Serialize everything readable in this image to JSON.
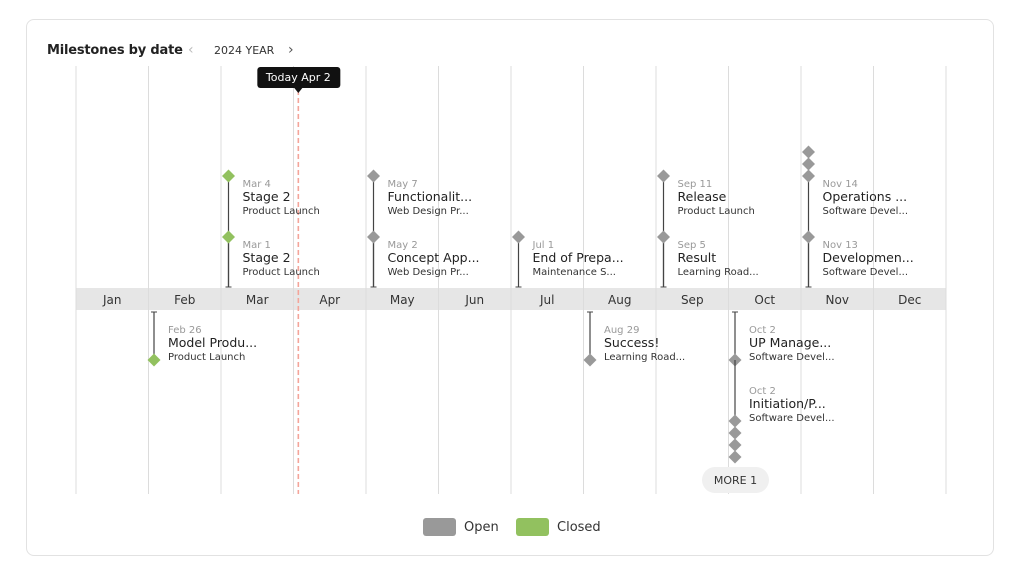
{
  "header": {
    "title": "Milestones by date",
    "prev_label": "‹",
    "year_label": "2024 YEAR",
    "next_label": "›"
  },
  "colors": {
    "open": "#999999",
    "closed": "#92c15f",
    "today": "#f4a59a",
    "band": "#e6e6e6",
    "grid": "#dcdcdc"
  },
  "chart_data": {
    "type": "timeline",
    "title": "Milestones by date",
    "year": 2024,
    "months": [
      "Jan",
      "Feb",
      "Mar",
      "Apr",
      "May",
      "Jun",
      "Jul",
      "Aug",
      "Sep",
      "Oct",
      "Nov",
      "Dec"
    ],
    "today": {
      "label": "Today Apr 2",
      "month": 4,
      "day": 2
    },
    "legend": [
      {
        "name": "Open",
        "color": "#999999"
      },
      {
        "name": "Closed",
        "color": "#92c15f"
      }
    ],
    "legend_position": "bottom",
    "milestones": [
      {
        "date": "Mar 4",
        "month": 3,
        "day": 4,
        "title": "Stage 2",
        "project": "Product Launch",
        "status": "closed",
        "side": "above",
        "slot": 2
      },
      {
        "date": "Mar 1",
        "month": 3,
        "day": 1,
        "title": "Stage 2",
        "project": "Product Launch",
        "status": "closed",
        "side": "above",
        "slot": 1
      },
      {
        "date": "May 7",
        "month": 5,
        "day": 7,
        "title": "Functionalit...",
        "project": "Web Design Pr...",
        "status": "open",
        "side": "above",
        "slot": 2
      },
      {
        "date": "May 2",
        "month": 5,
        "day": 2,
        "title": "Concept App...",
        "project": "Web Design Pr...",
        "status": "open",
        "side": "above",
        "slot": 1
      },
      {
        "date": "Jul 1",
        "month": 7,
        "day": 1,
        "title": "End of Prepa...",
        "project": "Maintenance S...",
        "status": "open",
        "side": "above",
        "slot": 1
      },
      {
        "date": "Sep 11",
        "month": 9,
        "day": 11,
        "title": "Release",
        "project": "Product Launch",
        "status": "open",
        "side": "above",
        "slot": 2
      },
      {
        "date": "Sep 5",
        "month": 9,
        "day": 5,
        "title": "Result",
        "project": "Learning Road...",
        "status": "open",
        "side": "above",
        "slot": 1
      },
      {
        "date": "Nov 14",
        "month": 11,
        "day": 14,
        "title": "Operations ...",
        "project": "Software Devel...",
        "status": "open",
        "side": "above",
        "slot": 2,
        "stacked_extra": 2
      },
      {
        "date": "Nov 13",
        "month": 11,
        "day": 13,
        "title": "Developmen...",
        "project": "Software Devel...",
        "status": "open",
        "side": "above",
        "slot": 1
      },
      {
        "date": "Feb 26",
        "month": 2,
        "day": 26,
        "title": "Model Produ...",
        "project": "Product Launch",
        "status": "closed",
        "side": "below",
        "slot": 1
      },
      {
        "date": "Aug 29",
        "month": 8,
        "day": 29,
        "title": "Success!",
        "project": "Learning Road...",
        "status": "open",
        "side": "below",
        "slot": 1
      },
      {
        "date": "Oct 2",
        "month": 10,
        "day": 2,
        "title": "UP Manage...",
        "project": "Software Devel...",
        "status": "open",
        "side": "below",
        "slot": 1
      },
      {
        "date": "Oct 2",
        "month": 10,
        "day": 2,
        "title": "Initiation/P...",
        "project": "Software Devel...",
        "status": "open",
        "side": "below",
        "slot": 2,
        "stacked_extra": 3
      }
    ],
    "more": {
      "label": "MORE 1",
      "month": 10,
      "day": 2
    }
  }
}
